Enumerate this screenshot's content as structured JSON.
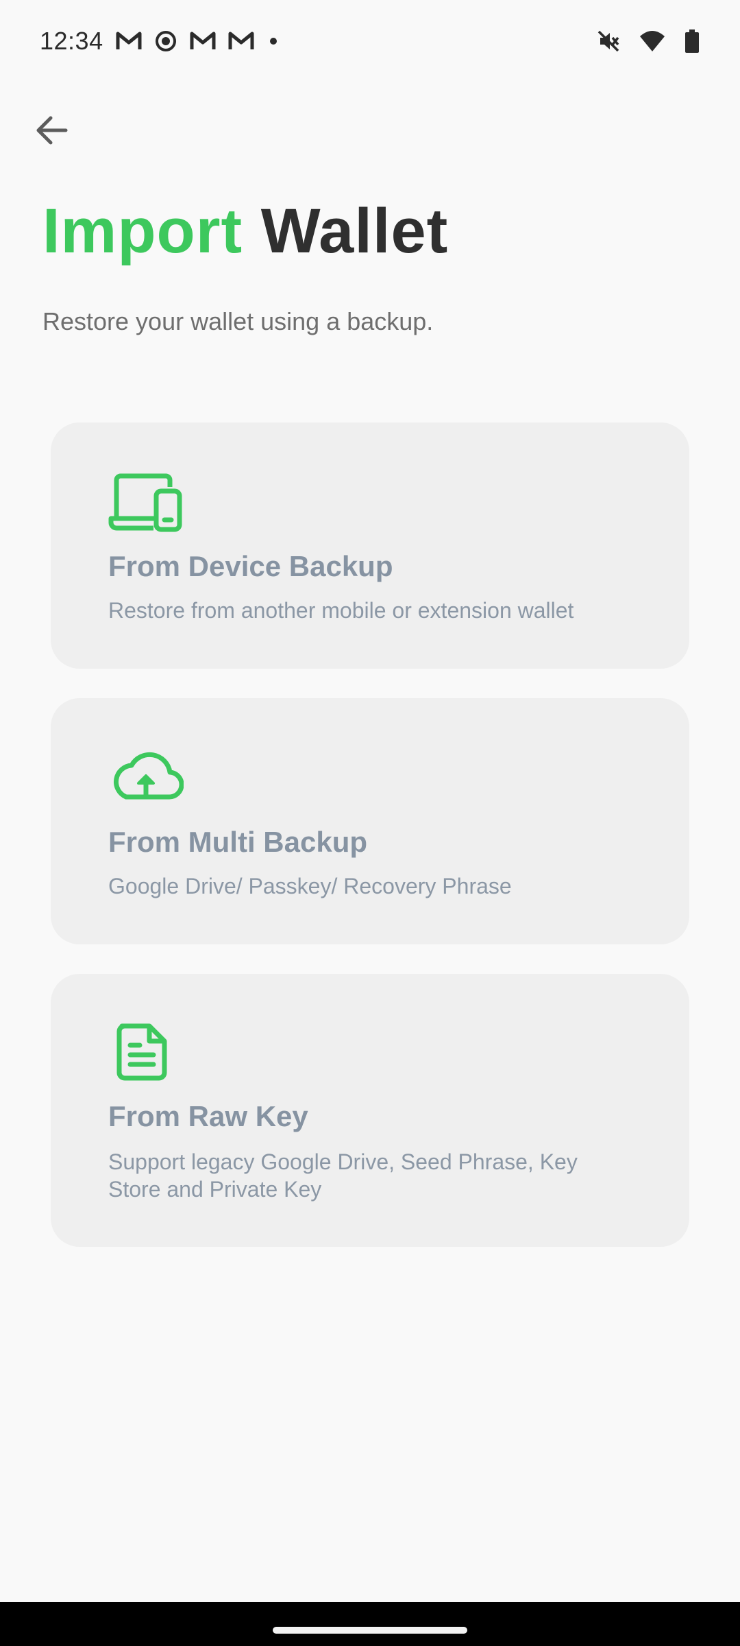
{
  "status_bar": {
    "time": "12:34",
    "icons": [
      "gmail-icon",
      "screen-record-icon",
      "gmail-icon",
      "gmail-icon",
      "notification-dot-icon",
      "mute-icon",
      "wifi-icon",
      "battery-icon"
    ]
  },
  "header": {
    "back_icon": "arrow-left-icon",
    "title_accent": "Import",
    "title_main": "Wallet",
    "subtitle": "Restore your wallet using a backup."
  },
  "colors": {
    "accent": "#3dc85d",
    "title": "#2f2f2f",
    "card_bg": "#efefef",
    "card_title": "#8693a2",
    "card_desc": "#8b97a5",
    "background": "#f9f9f9"
  },
  "options": [
    {
      "icon": "devices-icon",
      "title": "From Device Backup",
      "description": "Restore from another mobile or extension wallet"
    },
    {
      "icon": "cloud-upload-icon",
      "title": "From Multi Backup",
      "description": "Google Drive/ Passkey/ Recovery Phrase"
    },
    {
      "icon": "document-icon",
      "title": "From Raw Key",
      "description": "Support legacy Google Drive, Seed Phrase, Key Store and Private Key"
    }
  ]
}
